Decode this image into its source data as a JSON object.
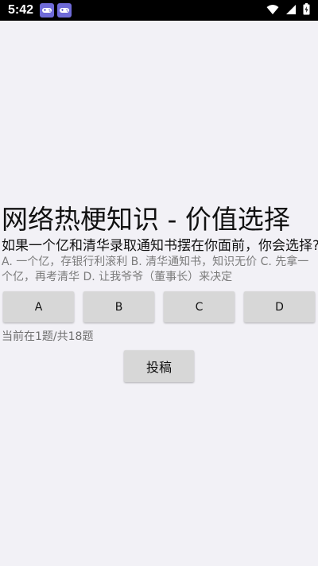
{
  "status_bar": {
    "time": "5:42",
    "icons": [
      "game-controller-icon",
      "game-controller-icon",
      "wifi-icon",
      "signal-icon",
      "battery-charging-icon"
    ]
  },
  "quiz": {
    "title": "网络热梗知识 - 价值选择",
    "question": "如果一个亿和清华录取通知书摆在你面前，你会选择?",
    "options_text": "A. 一个亿，存银行利滚利  B. 清华通知书，知识无价  C. 先拿一个亿，再考清华  D. 让我爷爷（董事长）来决定",
    "answers": [
      {
        "label": "A"
      },
      {
        "label": "B"
      },
      {
        "label": "C"
      },
      {
        "label": "D"
      }
    ],
    "progress": "当前在1题/共18题",
    "submit_label": "投稿"
  },
  "colors": {
    "background": "#f2f1f6",
    "status_bar": "#000000",
    "button": "#d7d7d7",
    "options_text": "#7b7b7b"
  }
}
